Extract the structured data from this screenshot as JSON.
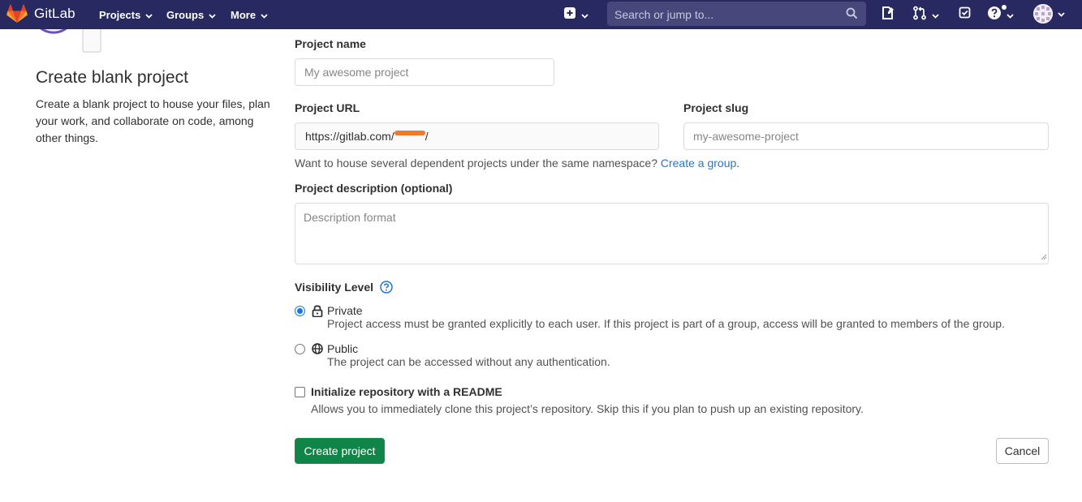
{
  "navbar": {
    "brand": "GitLab",
    "menus": [
      {
        "label": "Projects"
      },
      {
        "label": "Groups"
      },
      {
        "label": "More"
      }
    ],
    "search_placeholder": "Search or jump to...",
    "icons": [
      "gitlab-logo-icon",
      "plus-square-icon",
      "search-icon",
      "issues-icon",
      "merge-request-icon",
      "todo-check-icon",
      "help-icon",
      "user-avatar"
    ],
    "background": "#292961"
  },
  "left_panel": {
    "title": "Create blank project",
    "description": "Create a blank project to house your files, plan your work, and collaborate on code, among other things."
  },
  "form": {
    "project_name": {
      "label": "Project name",
      "placeholder": "My awesome project"
    },
    "project_url": {
      "label": "Project URL",
      "prefix": "https://gitlab.com/",
      "namespace_redacted": true,
      "suffix": "/"
    },
    "project_slug": {
      "label": "Project slug",
      "placeholder": "my-awesome-project"
    },
    "namespace_help": {
      "text": "Want to house several dependent projects under the same namespace?",
      "link": "Create a group",
      "end": "."
    },
    "description": {
      "label": "Project description (optional)",
      "placeholder": "Description format"
    },
    "visibility": {
      "label": "Visibility Level",
      "options": [
        {
          "label": "Private",
          "icon": "lock-icon",
          "description": "Project access must be granted explicitly to each user. If this project is part of a group, access will be granted to members of the group.",
          "selected": true
        },
        {
          "label": "Public",
          "icon": "globe-icon",
          "description": "The project can be accessed without any authentication.",
          "selected": false
        }
      ]
    },
    "readme": {
      "label": "Initialize repository with a README",
      "description": "Allows you to immediately clone this project’s repository. Skip this if you plan to push up an existing repository.",
      "checked": false
    },
    "create_button": "Create project",
    "cancel_button": "Cancel",
    "accent_color": "#1f78d1",
    "create_color": "#108548"
  }
}
